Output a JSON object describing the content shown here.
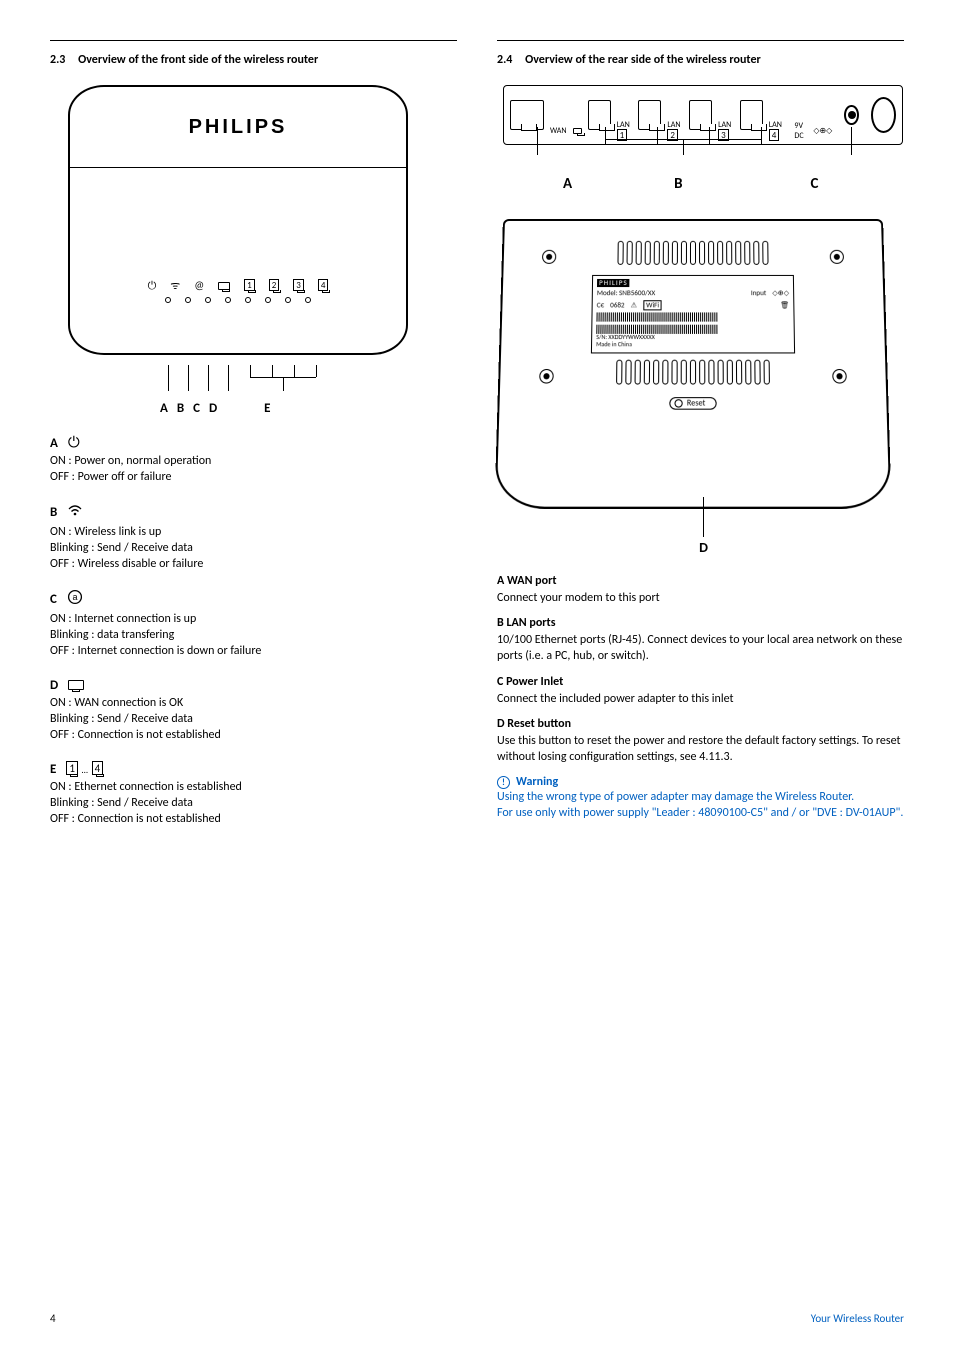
{
  "left": {
    "section_number": "2.3",
    "section_title": "Overview of the front side of the wireless router",
    "brand": "PHILIPS",
    "front_letters": {
      "a": "A",
      "b": "B",
      "c": "C",
      "d": "D",
      "e": "E"
    },
    "groups": {
      "A": {
        "letter": "A",
        "lines": [
          "ON : Power on, normal operation",
          "OFF : Power off or failure"
        ]
      },
      "B": {
        "letter": "B",
        "lines": [
          "ON : Wireless link is up",
          "Blinking : Send / Receive data",
          "OFF : Wireless disable or failure"
        ]
      },
      "C": {
        "letter": "C",
        "lines": [
          "ON : Internet connection is up",
          "Blinking : data transfering",
          "OFF : Internet connection is down or failure"
        ]
      },
      "D": {
        "letter": "D",
        "lines": [
          "ON : WAN connection is OK",
          "Blinking : Send / Receive data",
          "OFF : Connection is not established"
        ]
      },
      "E": {
        "letter": "E",
        "box1": "1",
        "dots": "...",
        "box4": "4",
        "lines": [
          "ON : Ethernet connection is established",
          "Blinking : Send / Receive data",
          "OFF : Connection is not established"
        ]
      }
    }
  },
  "right": {
    "section_number": "2.4",
    "section_title": "Overview of the rear side of the wireless router",
    "ports": {
      "wan": "WAN",
      "lan": "LAN",
      "n1": "1",
      "n2": "2",
      "n3": "3",
      "n4": "4",
      "dc": "9V DC"
    },
    "rear_letters": {
      "a": "A",
      "b": "B",
      "c": "C",
      "d": "D"
    },
    "plate": {
      "brand": "PHILIPS",
      "model": "Model: SNB5600/XX",
      "input": "Input",
      "ce": "0682",
      "wifi": "WiFi",
      "sn": "S/N: XXDDYYWWXXXXX",
      "made": "Made in China",
      "reset": "Reset"
    },
    "desc": {
      "A": {
        "h": "A   WAN port",
        "p": "Connect your modem to this port"
      },
      "B": {
        "h": "B   LAN ports",
        "p": "10/100 Ethernet ports (RJ-45). Connect devices to your local area network on these ports (i.e. a PC, hub, or switch)."
      },
      "C": {
        "h": "C   Power Inlet",
        "p": "Connect the included power adapter to this inlet"
      },
      "D": {
        "h": "D   Reset button",
        "p": "Use this button to reset the power and restore the default factory settings. To reset without losing configuration settings, see 4.11.3."
      }
    },
    "warning": {
      "title": "Warning",
      "body1": "Using the wrong type of power adapter may damage the Wireless Router.",
      "body2": "For use only with power supply \"Leader : 48090100-C5\" and / or \"DVE : DV-01AUP\"."
    }
  },
  "footer": {
    "page": "4",
    "right": "Your Wireless Router"
  }
}
